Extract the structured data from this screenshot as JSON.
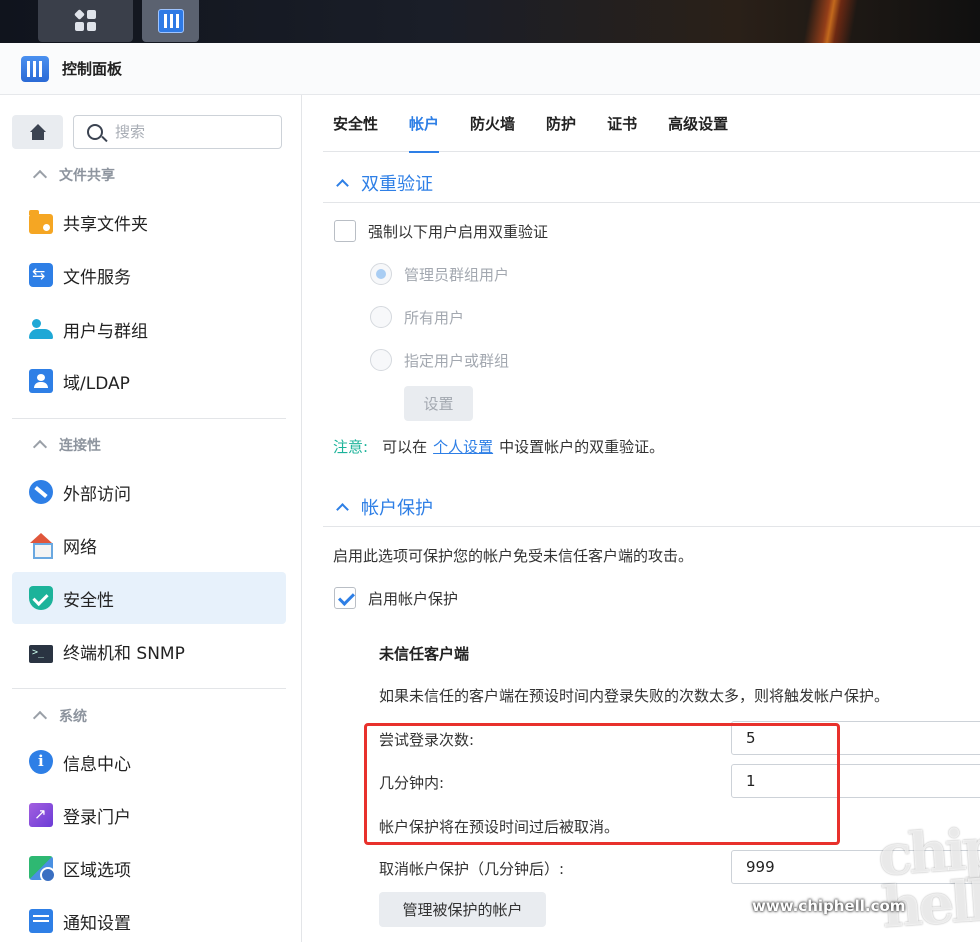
{
  "window": {
    "title": "控制面板"
  },
  "sidebar": {
    "search_placeholder": "搜索",
    "sections": [
      {
        "label": "文件共享",
        "items": [
          "共享文件夹",
          "文件服务",
          "用户与群组",
          "域/LDAP"
        ]
      },
      {
        "label": "连接性",
        "items": [
          "外部访问",
          "网络",
          "安全性",
          "终端机和 SNMP"
        ]
      },
      {
        "label": "系统",
        "items": [
          "信息中心",
          "登录门户",
          "区域选项",
          "通知设置"
        ]
      }
    ],
    "active_item": "安全性"
  },
  "tabs": [
    "安全性",
    "帐户",
    "防火墙",
    "防护",
    "证书",
    "高级设置"
  ],
  "active_tab": "帐户",
  "two_factor": {
    "title": "双重验证",
    "enforce_label": "强制以下用户启用双重验证",
    "enforce_checked": false,
    "options": [
      "管理员群组用户",
      "所有用户",
      "指定用户或群组"
    ],
    "selected_option": "管理员群组用户",
    "settings_button": "设置",
    "note_label": "注意:",
    "note_before": "可以在",
    "note_link": "个人设置",
    "note_after": "中设置帐户的双重验证。"
  },
  "account_protection": {
    "title": "帐户保护",
    "description": "启用此选项可保护您的帐户免受未信任客户端的攻击。",
    "enable_label": "启用帐户保护",
    "enable_checked": true,
    "untrusted": {
      "heading": "未信任客户端",
      "description": "如果未信任的客户端在预设时间内登录失败的次数太多，则将触发帐户保护。",
      "attempts_label": "尝试登录次数:",
      "attempts_value": "5",
      "minutes_label": "几分钟内:",
      "minutes_value": "1",
      "cancel_note": "帐户保护将在预设时间过后被取消。",
      "cancel_after_label": "取消帐户保护（几分钟后）:",
      "cancel_after_value": "999",
      "manage_button": "管理被保护的帐户"
    }
  },
  "watermark": {
    "logo": "chip hell",
    "url": "www.chiphell.com"
  },
  "colors": {
    "accent": "#2e7fe6",
    "highlight_box": "#e8312c",
    "note_green": "#1cb39a"
  }
}
